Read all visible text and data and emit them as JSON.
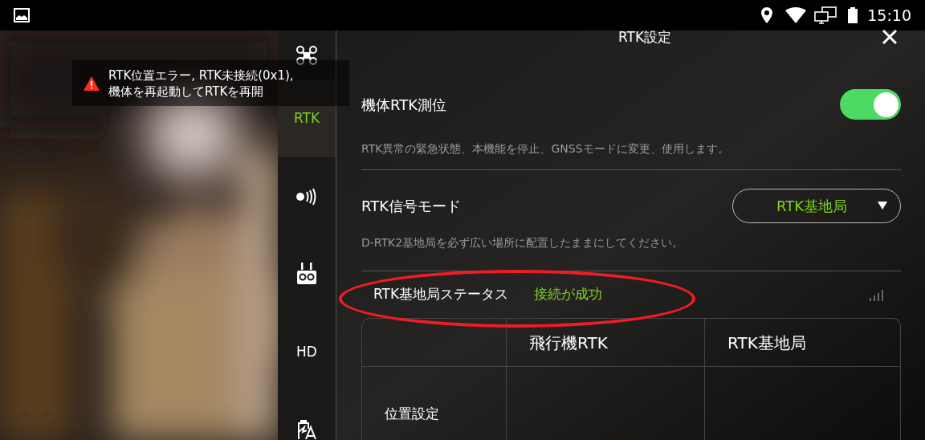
{
  "status_bar": {
    "time": "15:10"
  },
  "toast": {
    "lines": [
      "RTK位置エラー, RTK未接続(0x1),",
      "機体を再起動してRTKを再開"
    ]
  },
  "sidebar": {
    "items": [
      {
        "kind": "drone",
        "selected": false
      },
      {
        "kind": "text",
        "label": "RTK",
        "selected": true
      },
      {
        "kind": "signal",
        "selected": false
      },
      {
        "kind": "remote",
        "selected": false
      },
      {
        "kind": "text",
        "label": "HD",
        "selected": false
      },
      {
        "kind": "battery",
        "selected": false
      }
    ]
  },
  "panel": {
    "title": "RTK設定",
    "rtk_positioning": {
      "label": "機体RTK測位",
      "on": true,
      "description": "RTK異常の緊急状態、本機能を停止、GNSSモードに変更、使用します。"
    },
    "signal_mode": {
      "label": "RTK信号モード",
      "value": "RTK基地局",
      "description": "D-RTK2基地局を必ず広い場所に配置したままにしてください。"
    },
    "base_status": {
      "label": "RTK基地局ステータス",
      "value": "接続が成功"
    },
    "table": {
      "columns": [
        "",
        "飛行機RTK",
        "RTK基地局"
      ],
      "rows": [
        [
          "位置設定",
          "",
          ""
        ]
      ]
    }
  }
}
